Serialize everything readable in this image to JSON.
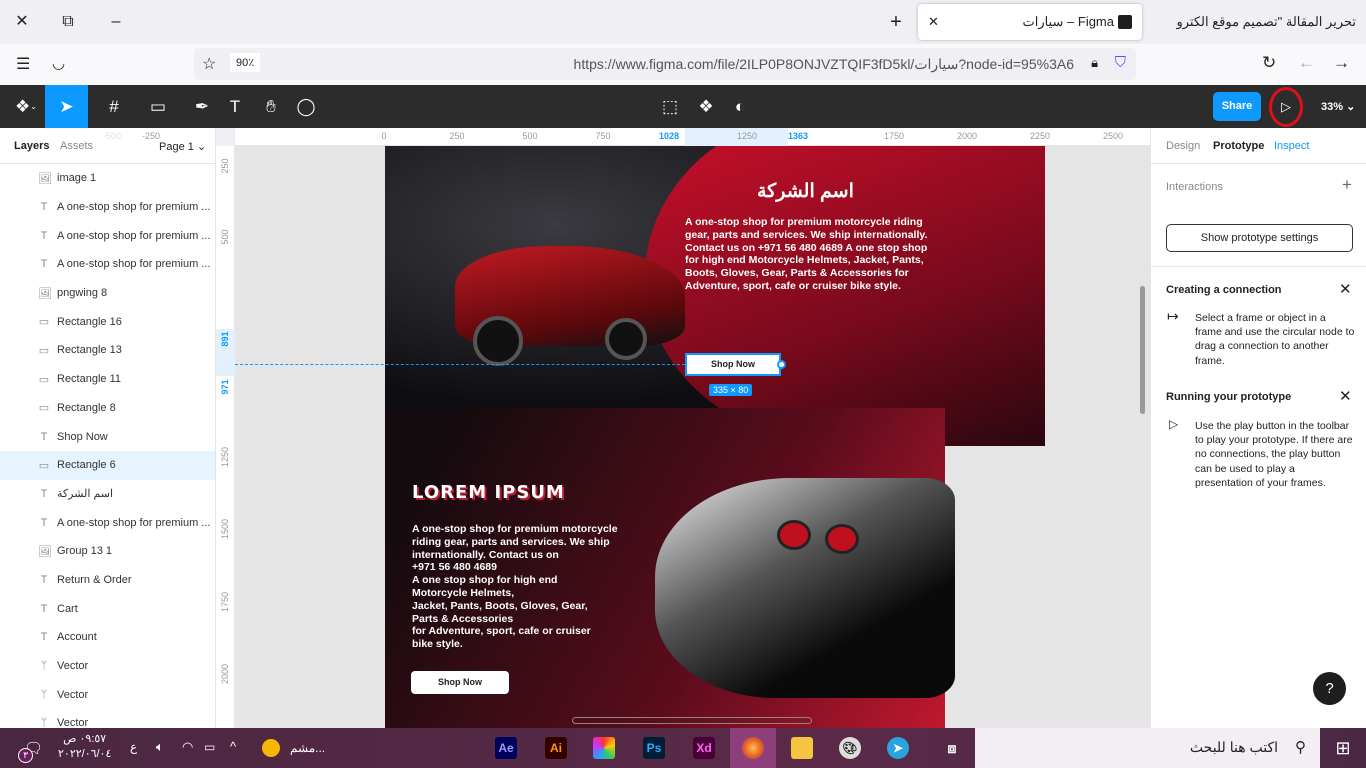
{
  "browser": {
    "tabs": [
      {
        "title": "سيارات – Figma",
        "active": true
      },
      {
        "title": "تحرير المقالة \"تصميم موقع الكترو",
        "active": false
      }
    ],
    "url": "https://www.figma.com/file/2ILP0P8ONJVZTQIF3fD5kl/سيارات?node-id=95%3A6",
    "zoom": "90٪"
  },
  "toolbar": {
    "share_label": "Share",
    "zoom": "33%",
    "accent": "#0d99ff"
  },
  "left_panel": {
    "tabs": [
      "Layers",
      "Assets"
    ],
    "page": "Page 1",
    "layers": [
      {
        "icon": "image-icon",
        "name": "image 1"
      },
      {
        "icon": "text-icon",
        "name": "A one-stop shop for premium ..."
      },
      {
        "icon": "text-icon",
        "name": "A one-stop shop for premium ..."
      },
      {
        "icon": "text-icon",
        "name": "A one-stop shop for premium ..."
      },
      {
        "icon": "image-icon",
        "name": "pngwing 8"
      },
      {
        "icon": "rectangle-icon",
        "name": "Rectangle 16"
      },
      {
        "icon": "rectangle-icon",
        "name": "Rectangle 13"
      },
      {
        "icon": "rectangle-icon",
        "name": "Rectangle 11"
      },
      {
        "icon": "rectangle-icon",
        "name": "Rectangle 8"
      },
      {
        "icon": "text-icon",
        "name": "Shop Now"
      },
      {
        "icon": "rectangle-icon",
        "name": "Rectangle 6",
        "selected": true
      },
      {
        "icon": "text-icon",
        "name": "اسم الشركة"
      },
      {
        "icon": "text-icon",
        "name": "A one-stop shop for premium ..."
      },
      {
        "icon": "image-icon",
        "name": "Group 13 1"
      },
      {
        "icon": "text-icon",
        "name": "Return & Order"
      },
      {
        "icon": "text-icon",
        "name": "Cart"
      },
      {
        "icon": "text-icon",
        "name": "Account"
      },
      {
        "icon": "vector-icon",
        "name": "Vector"
      },
      {
        "icon": "vector-icon",
        "name": "Vector"
      },
      {
        "icon": "vector-icon",
        "name": "Vector"
      }
    ]
  },
  "rulers": {
    "h": [
      "-500",
      "-250",
      "0",
      "250",
      "500",
      "750",
      "1028",
      "1250",
      "1363",
      "1750",
      "2000",
      "2250",
      "2500"
    ],
    "v": [
      "250",
      "500",
      "891",
      "971",
      "1250",
      "1500",
      "1750",
      "2000"
    ]
  },
  "canvas": {
    "hero": {
      "company": "اسم الشركة",
      "body": "A one-stop shop for premium motorcycle riding gear, parts and services. We ship internationally. Contact us on +971 56 480 4689 A one stop shop for high end Motorcycle Helmets, Jacket, Pants, Boots, Gloves, Gear, Parts & Accessories for Adventure, sport, cafe or cruiser bike style.",
      "button": "Shop Now",
      "size": "335 × 80"
    },
    "section2": {
      "title": "LOREM IPSUM",
      "lines": [
        "A one-stop shop for premium motorcycle",
        "riding gear, parts and services. We ship",
        "internationally. Contact us on",
        "+971 56 480 4689",
        "A one stop shop for high end",
        "Motorcycle Helmets,",
        "Jacket, Pants, Boots, Gloves, Gear,",
        "Parts & Accessories",
        "for Adventure, sport, cafe or cruiser",
        "bike style."
      ],
      "button": "Shop Now"
    }
  },
  "right_panel": {
    "tabs": [
      "Design",
      "Prototype",
      "Inspect"
    ],
    "interactions": "Interactions",
    "show_settings": "Show prototype settings",
    "creating": {
      "title": "Creating a connection",
      "body": "Select a frame or object in a frame and use the circular node to drag a connection to another frame."
    },
    "running": {
      "title": "Running your prototype",
      "body": "Use the play button in the toolbar to play your prototype. If there are no connections, the play button can be used to play a presentation of your frames."
    },
    "help": "?"
  },
  "taskbar": {
    "search": "اكتب هنا للبحث",
    "time": "٠٩:٥٧ ص",
    "date": "٢٠٢٢/٠٦/٠٤",
    "lang": "ع",
    "weather": "مشم...",
    "notif": "٣",
    "apps": [
      "Ae",
      "Ai",
      "Cc",
      "Ps",
      "Xd"
    ]
  }
}
